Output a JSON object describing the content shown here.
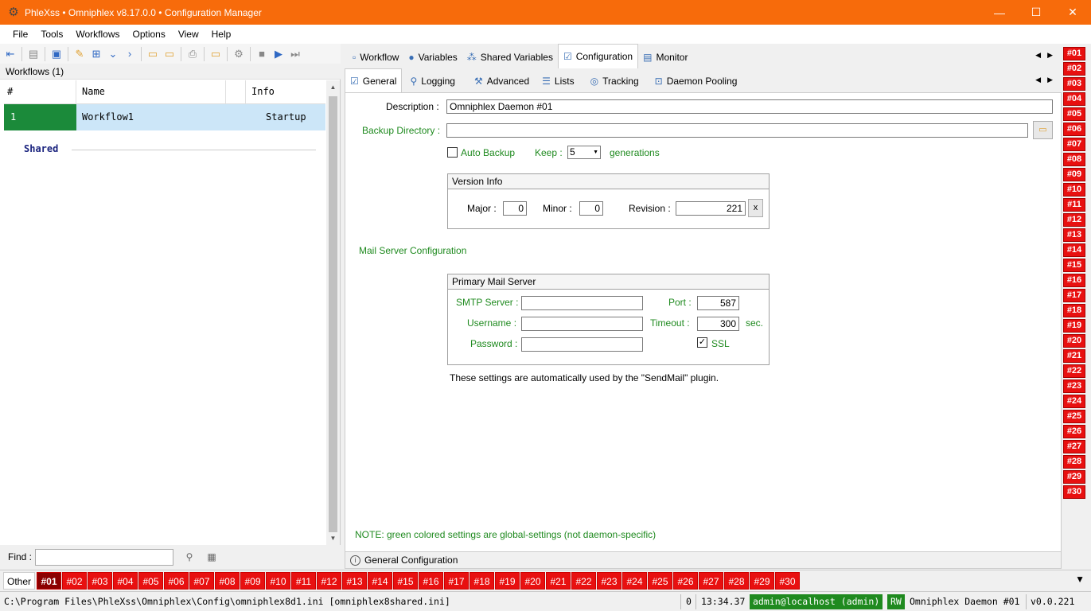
{
  "window": {
    "title": "PhleXss • Omniphlex v8.17.0.0 • Configuration Manager",
    "minimize_icon": "minimize-icon",
    "maximize_icon": "maximize-icon",
    "close_icon": "close-icon"
  },
  "menu": [
    "File",
    "Tools",
    "Workflows",
    "Options",
    "View",
    "Help"
  ],
  "left": {
    "header": "Workflows (1)",
    "columns": {
      "num": "#",
      "name": "Name",
      "info": "Info"
    },
    "row": {
      "num": "1",
      "name": "Workflow1",
      "info": "Startup"
    },
    "shared_label": "Shared",
    "find_label": "Find :",
    "find_value": ""
  },
  "tabs_top": [
    "Workflow",
    "Variables",
    "Shared Variables",
    "Configuration",
    "Monitor"
  ],
  "tabs_sub": [
    "General",
    "Logging",
    "Advanced",
    "Lists",
    "Tracking",
    "Daemon Pooling"
  ],
  "general": {
    "description_label": "Description :",
    "description_value": "Omniphlex Daemon #01",
    "backup_dir_label": "Backup Directory :",
    "backup_dir_value": "",
    "auto_backup_label": "Auto Backup",
    "keep_label": "Keep :",
    "keep_value": "5",
    "generations_label": "generations",
    "version_title": "Version Info",
    "major_label": "Major :",
    "major_value": "0",
    "minor_label": "Minor :",
    "minor_value": "0",
    "revision_label": "Revision :",
    "revision_value": "221",
    "reset_label": "x",
    "mail_section": "Mail Server Configuration",
    "mail_group_title": "Primary Mail Server",
    "smtp_label": "SMTP Server :",
    "smtp_value": "",
    "port_label": "Port :",
    "port_value": "587",
    "username_label": "Username :",
    "username_value": "",
    "timeout_label": "Timeout :",
    "timeout_value": "300",
    "sec_label": "sec.",
    "password_label": "Password :",
    "password_value": "",
    "ssl_label": "SSL",
    "ssl_checked": true,
    "mail_note": "These settings are automatically used by the \"SendMail\" plugin.",
    "global_note": "NOTE: green colored settings are global-settings (not daemon-specific)",
    "section_footer": "General Configuration"
  },
  "daemons": [
    "#01",
    "#02",
    "#03",
    "#04",
    "#05",
    "#06",
    "#07",
    "#08",
    "#09",
    "#10",
    "#11",
    "#12",
    "#13",
    "#14",
    "#15",
    "#16",
    "#17",
    "#18",
    "#19",
    "#20",
    "#21",
    "#22",
    "#23",
    "#24",
    "#25",
    "#26",
    "#27",
    "#28",
    "#29",
    "#30"
  ],
  "bottom_tabs": {
    "other": "Other",
    "active": "#01"
  },
  "status": {
    "path": "C:\\Program Files\\PhleXss\\Omniphlex\\Config\\omniphlex8d1.ini [omniphlex8shared.ini]",
    "count": "0",
    "time": "13:34.37",
    "user": "admin@localhost (admin)",
    "mode": "RW",
    "daemon": "Omniphlex Daemon #01",
    "version": "v0.0.221"
  },
  "colors": {
    "titlebar": "#f76b0b",
    "daemon_tag": "#e81010",
    "green_setting": "#1f8a1f"
  }
}
